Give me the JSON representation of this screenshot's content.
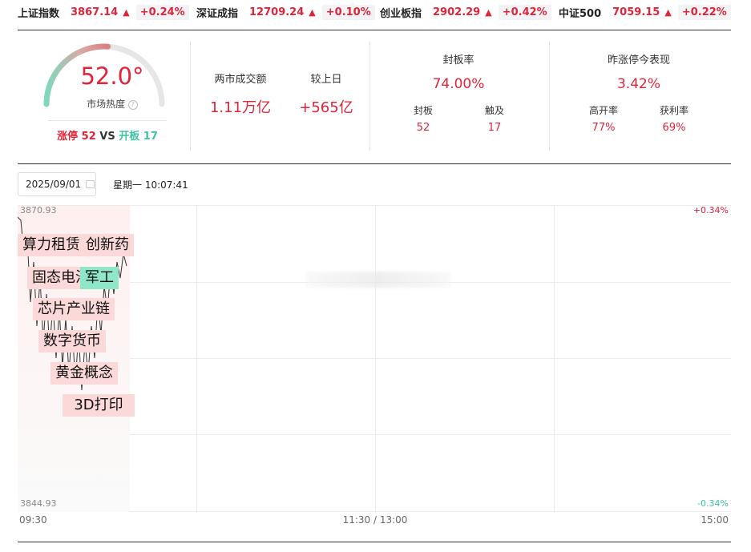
{
  "indices": [
    {
      "name": "上证指数",
      "price": "3867.14",
      "arrow": "▲",
      "pct": "+0.24%"
    },
    {
      "name": "深证成指",
      "price": "12709.24",
      "arrow": "▲",
      "pct": "+0.10%"
    },
    {
      "name": "创业板指",
      "price": "2902.29",
      "arrow": "▲",
      "pct": "+0.42%"
    },
    {
      "name": "中证500",
      "price": "7059.15",
      "arrow": "▲",
      "pct": "+0.22%"
    }
  ],
  "heat": {
    "value": "52.0°",
    "value_fraction": 0.52,
    "label": "市场热度",
    "help_icon": "question-circle-icon",
    "limit_up_label": "涨停",
    "limit_up_count": "52",
    "vs": "VS",
    "open_label": "开板",
    "open_count": "17"
  },
  "turnover": {
    "label": "两市成交额",
    "value": "1.11万亿",
    "cmp_label": "较上日",
    "cmp_value": "+565亿"
  },
  "seal": {
    "title": "封板率",
    "value": "74.00%",
    "sub": [
      {
        "label": "封板",
        "value": "52"
      },
      {
        "label": "触及",
        "value": "17"
      }
    ]
  },
  "yesterday": {
    "title": "昨涨停今表现",
    "value": "3.42%",
    "sub": [
      {
        "label": "高开率",
        "value": "77%"
      },
      {
        "label": "获利率",
        "value": "69%"
      }
    ]
  },
  "toolbar": {
    "date": "2025/09/01",
    "calendar_icon": "calendar-icon",
    "weekday_time": "星期一 10:07:41"
  },
  "chart": {
    "y_top": "3870.93",
    "y_bottom": "3844.93",
    "pct_top": "+0.34%",
    "pct_bottom": "-0.34%",
    "x_start": "09:30",
    "x_mid": "11:30 / 13:00",
    "x_end": "15:00"
  },
  "tags": [
    "算力租赁",
    "创新药",
    "固态电池",
    "军工",
    "芯片产业链",
    "数字货币",
    "黄金概念",
    "3D打印"
  ],
  "colors": {
    "up": "#e0243a",
    "down": "#3ec3a1",
    "tag_bg": "#fbd9d9",
    "tag_green_bg": "#8fe6c8"
  }
}
